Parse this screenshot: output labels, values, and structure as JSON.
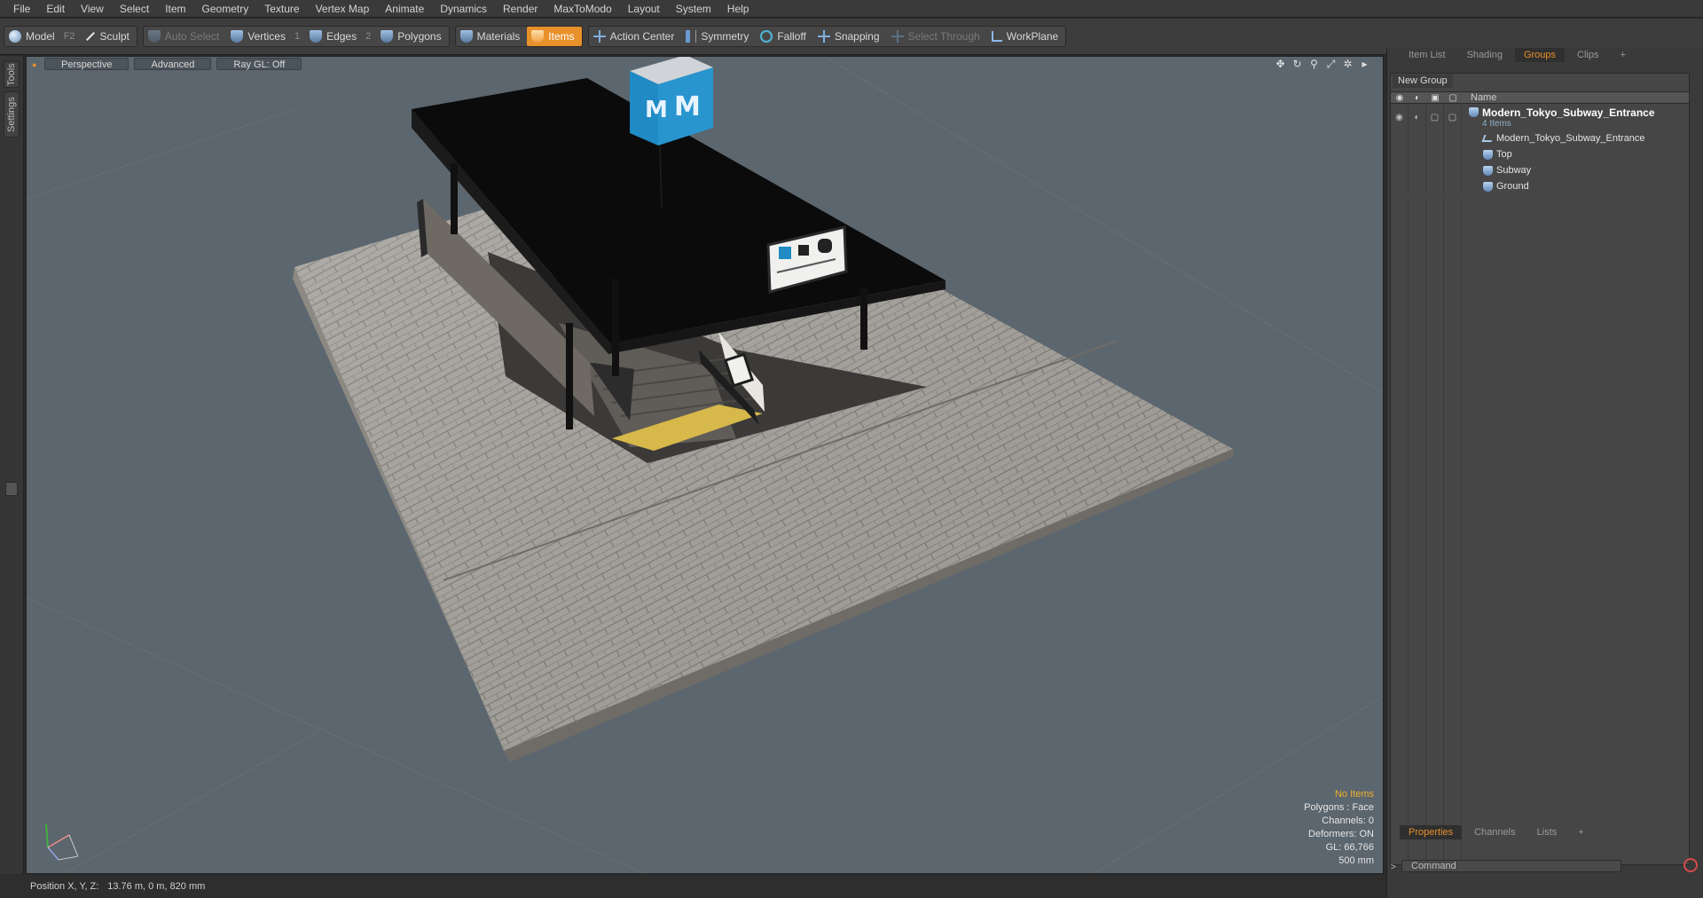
{
  "menu": [
    "File",
    "Edit",
    "View",
    "Select",
    "Item",
    "Geometry",
    "Texture",
    "Vertex Map",
    "Animate",
    "Dynamics",
    "Render",
    "MaxToModo",
    "Layout",
    "System",
    "Help"
  ],
  "toolbar": {
    "model": "Model",
    "model_key": "F2",
    "sculpt": "Sculpt",
    "auto_select": "Auto Select",
    "vertices": "Vertices",
    "vertices_key": "1",
    "edges": "Edges",
    "edges_key": "2",
    "polygons": "Polygons",
    "materials": "Materials",
    "items": "Items",
    "action_center": "Action Center",
    "symmetry": "Symmetry",
    "falloff": "Falloff",
    "snapping": "Snapping",
    "select_through": "Select Through",
    "workplane": "WorkPlane"
  },
  "left_tabs": {
    "tools": "Tools",
    "settings": "Settings"
  },
  "viewport": {
    "view_mode": "Perspective",
    "shading": "Advanced",
    "raygl": "Ray GL: Off",
    "stats": {
      "selection": "No Items",
      "polygons": "Polygons : Face",
      "channels": "Channels: 0",
      "deformers": "Deformers: ON",
      "gl": "GL: 66,766",
      "unit": "500 mm"
    },
    "sign_logo": "M"
  },
  "status": {
    "position_label": "Position X, Y, Z:",
    "position_value": "13.76 m, 0 m, 820 mm"
  },
  "right_panel": {
    "tabs": [
      "Item List",
      "Shading",
      "Groups",
      "Clips",
      "+"
    ],
    "active_tab": "Groups",
    "new_group": "New Group",
    "name_header": "Name",
    "tree": {
      "root": "Modern_Tokyo_Subway_Entrance",
      "root_sub": "4 Items",
      "children": [
        {
          "label": "Modern_Tokyo_Subway_Entrance",
          "icon": "locator-icon"
        },
        {
          "label": "Top",
          "icon": "mesh-icon"
        },
        {
          "label": "Subway",
          "icon": "mesh-icon"
        },
        {
          "label": "Ground",
          "icon": "mesh-icon"
        }
      ]
    },
    "bottom_tabs": [
      "Properties",
      "Channels",
      "Lists",
      "+"
    ],
    "command_placeholder": "Command"
  },
  "colors": {
    "accent": "#e8902a",
    "viewport_bg": "#5c666e",
    "sign_blue": "#1f8ac4"
  }
}
